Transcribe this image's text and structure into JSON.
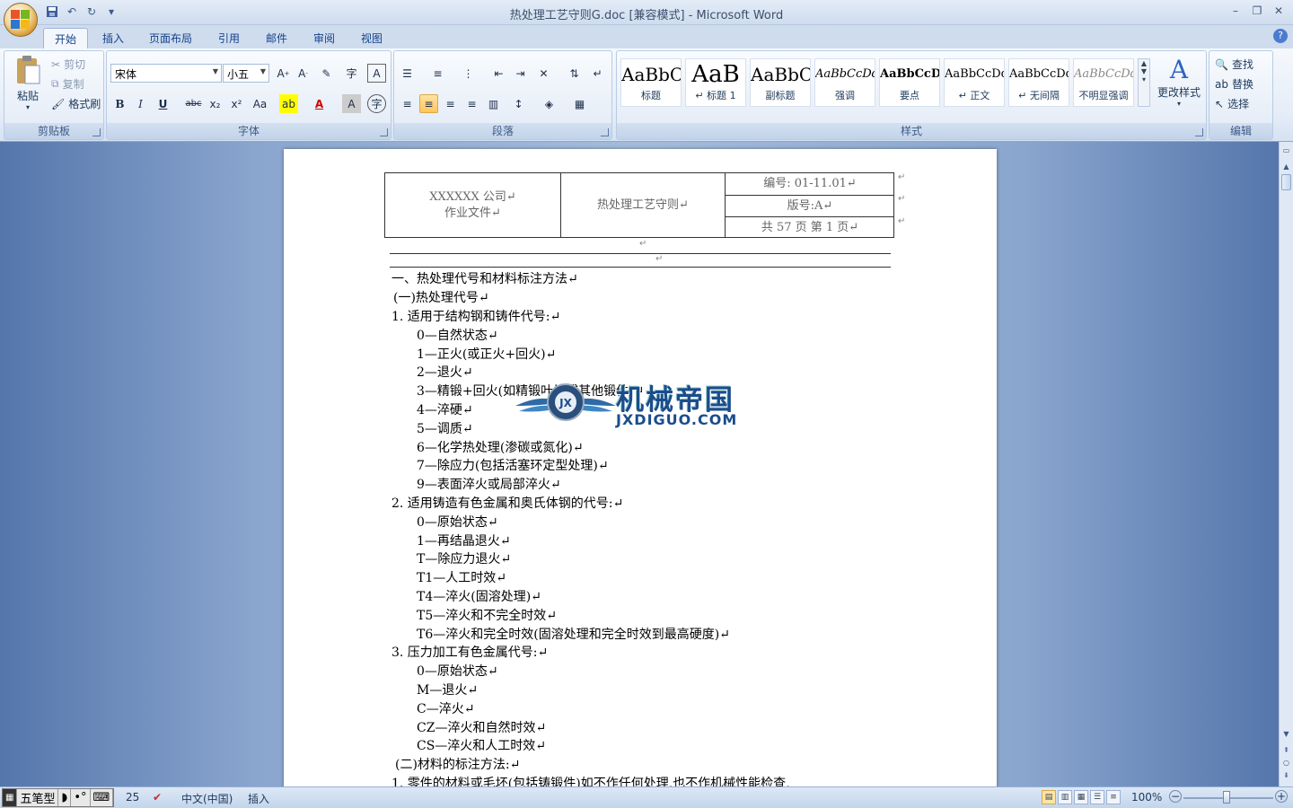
{
  "window": {
    "title": "热处理工艺守则G.doc [兼容模式] - Microsoft Word",
    "controls": [
      "–",
      "❐",
      "✕"
    ]
  },
  "qat": {
    "save": "💾",
    "undo": "↶",
    "redo": "↻",
    "customize": "▾"
  },
  "tabs": [
    {
      "label": "开始"
    },
    {
      "label": "插入"
    },
    {
      "label": "页面布局"
    },
    {
      "label": "引用"
    },
    {
      "label": "邮件"
    },
    {
      "label": "审阅"
    },
    {
      "label": "视图"
    }
  ],
  "ribbon": {
    "clipboard": {
      "group": "剪贴板",
      "paste": "粘贴",
      "cut": "剪切",
      "copy": "复制",
      "format_painter": "格式刷"
    },
    "font": {
      "group": "字体",
      "font_name": "宋体",
      "font_size": "小五",
      "buttons": {
        "bold": "B",
        "italic": "I",
        "underline": "U",
        "strike": "abc",
        "sub": "x₂",
        "sup": "x²",
        "case": "Aa",
        "color": "A",
        "border": "A",
        "phonetic": "字"
      }
    },
    "paragraph": {
      "group": "段落"
    },
    "styles": {
      "group": "样式",
      "change": "更改样式",
      "items": [
        {
          "sample": "AaBbC",
          "name": "标题"
        },
        {
          "sample": "AaB",
          "name": "↵ 标题 1"
        },
        {
          "sample": "AaBbC",
          "name": "副标题"
        },
        {
          "sample": "AaBbCcDd",
          "name": "强调"
        },
        {
          "sample": "AaBbCcD",
          "name": "要点"
        },
        {
          "sample": "AaBbCcDd",
          "name": "↵ 正文"
        },
        {
          "sample": "AaBbCcDd",
          "name": "↵ 无间隔"
        },
        {
          "sample": "AaBbCcDd",
          "name": "不明显强调"
        }
      ]
    },
    "editing": {
      "group": "编辑",
      "find": "查找",
      "replace": "替换",
      "select": "选择"
    }
  },
  "doc": {
    "header": {
      "company": "XXXXXX 公司↵",
      "doctype": "作业文件↵",
      "title": "热处理工艺守则↵",
      "number": "编号:   01-11.01↵",
      "version": "版号:A↵",
      "pages": "共 57    页         第  1  页↵"
    },
    "lines": [
      "一、热处理代号和材料标注方法↵",
      "(一)热处理代号↵",
      "1. 适用于结构钢和铸件代号:↵",
      "0—自然状态↵",
      "1—正火(或正火+回火)↵",
      "2—退火↵",
      "3—精锻+回火(如精锻叶片或其他锻件)↵",
      "4—淬硬↵",
      "5—调质↵",
      "6—化学热处理(渗碳或氮化)↵",
      "7—除应力(包括活塞环定型处理)↵",
      "9—表面淬火或局部淬火↵",
      "2.  适用铸造有色金属和奥氏体钢的代号:↵",
      "0—原始状态↵",
      "1—再结晶退火↵",
      "T—除应力退火↵",
      "T1—人工时效↵",
      "T4—淬火(固溶处理)↵",
      "T5—淬火和不完全时效↵",
      "T6—淬火和完全时效(固溶处理和完全时效到最高硬度)↵",
      "3.  压力加工有色金属代号:↵",
      "0—原始状态↵",
      "M—退火↵",
      "C—淬火↵",
      "CZ—淬火和自然时效↵",
      "CS—淬火和人工时效↵",
      "(二)材料的标注方法:↵",
      "1.    零件的材料或毛坯(包括铸锻件)如不作任何处理,也不作机械性能检查,"
    ],
    "watermark": {
      "text": "机械帝国",
      "sub": "JXDIGUO.COM",
      "badge": "JX"
    }
  },
  "statusbar": {
    "ime": [
      "五笔型",
      "◗",
      "•°",
      "⌨"
    ],
    "page_count_tail": "25",
    "language": "中文(中国)",
    "mode": "插入",
    "zoom": "100%"
  }
}
